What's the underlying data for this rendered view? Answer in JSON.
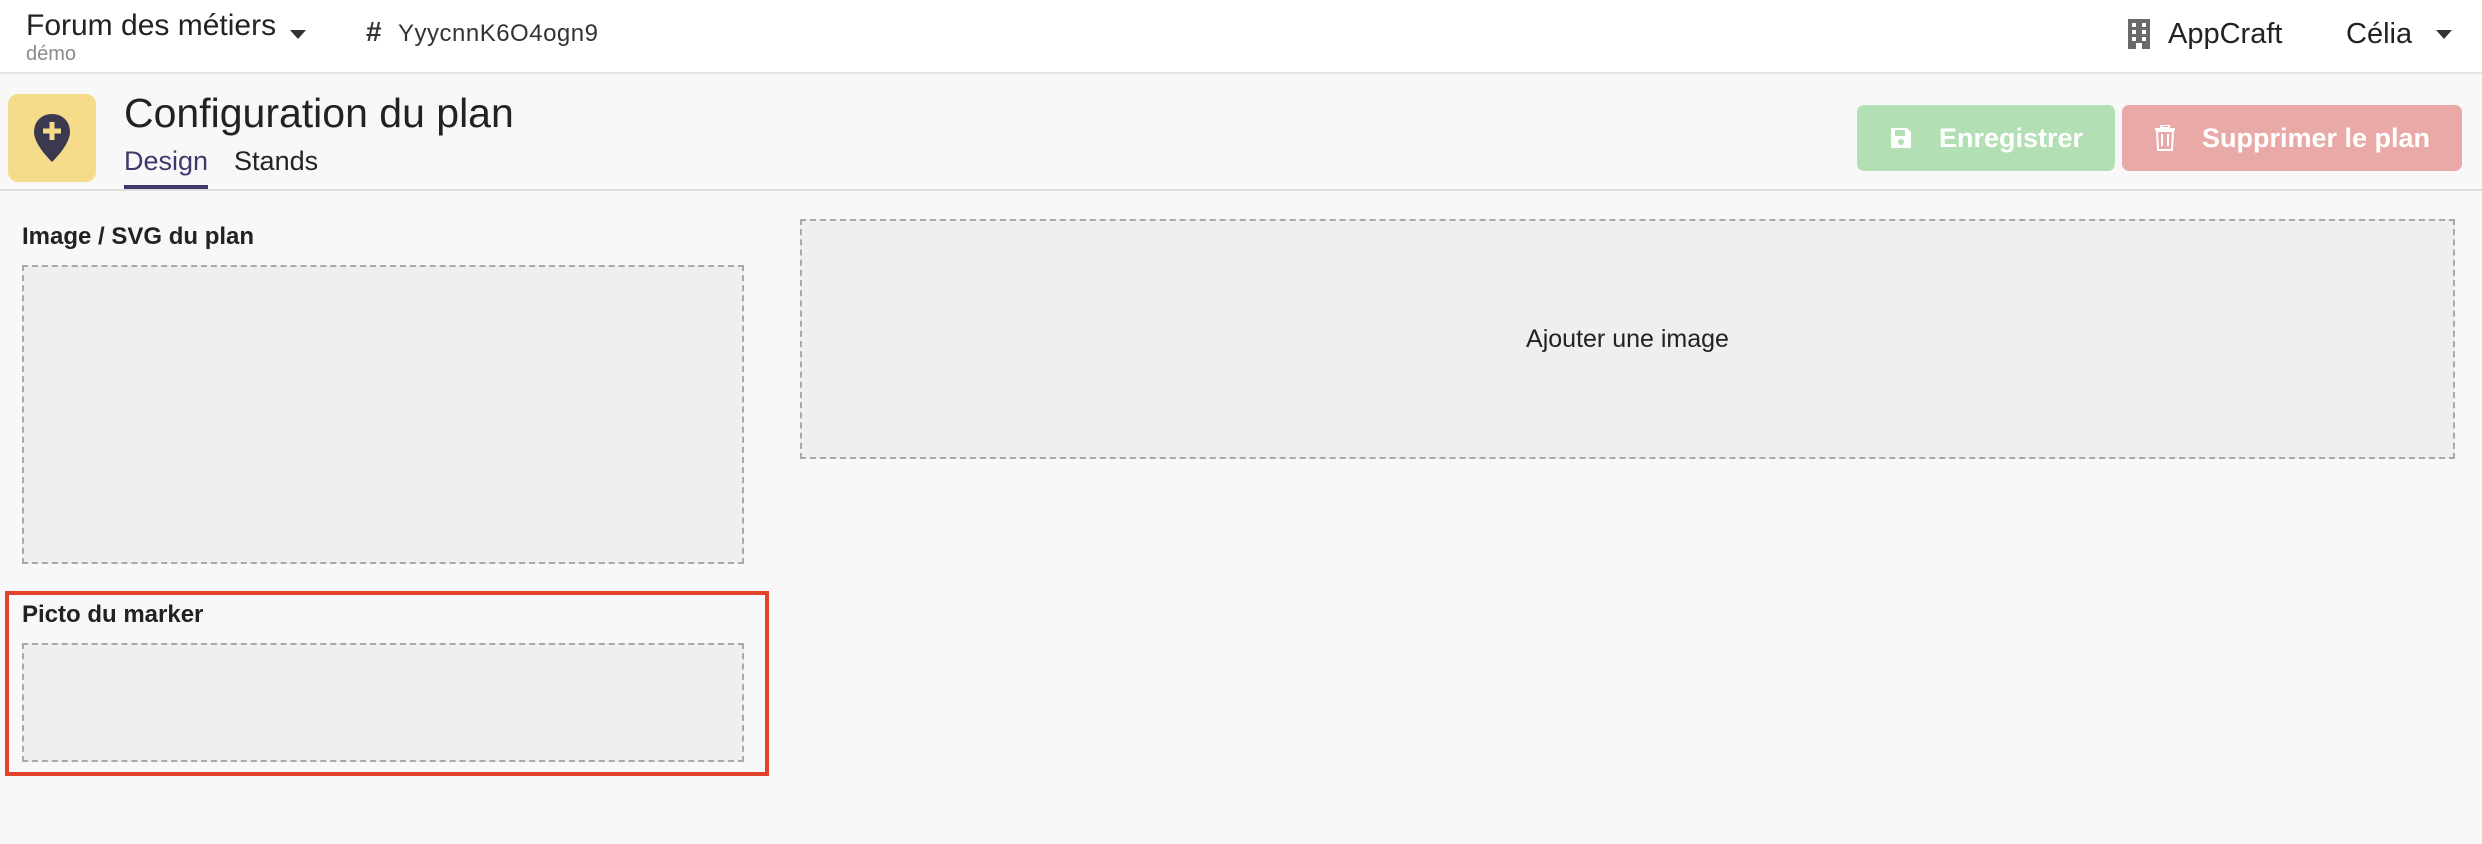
{
  "topbar": {
    "app_name": "Forum des métiers",
    "app_subtitle": "démo",
    "app_id_prefix": "#",
    "app_id": "YyycnnK6O4ogn9",
    "org_label": "AppCraft",
    "user_label": "Célia"
  },
  "header": {
    "title": "Configuration du plan",
    "tabs": [
      {
        "label": "Design",
        "active": true
      },
      {
        "label": "Stands",
        "active": false
      }
    ],
    "save_label": "Enregistrer",
    "delete_label": "Supprimer le plan"
  },
  "content": {
    "plan_image_label": "Image / SVG du plan",
    "add_image_text": "Ajouter une image",
    "marker_label": "Picto du marker"
  },
  "colors": {
    "accent": "#3d3a6b",
    "page_icon_bg": "#f5dc8a",
    "save_button": "#b3dfb4",
    "delete_button": "#e9a9a7",
    "highlight": "#e0432a"
  },
  "icons": {
    "page": "map-marker-plus-icon",
    "org": "building-icon",
    "save": "floppy-disk-icon",
    "delete": "trash-icon"
  }
}
